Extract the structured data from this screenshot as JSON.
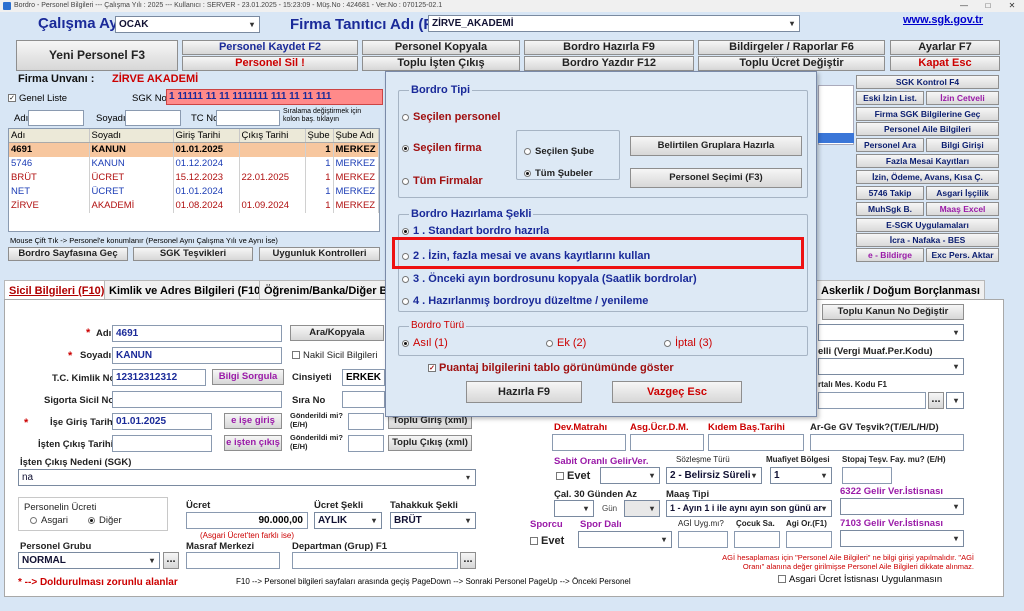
{
  "titlebar": {
    "text": "Bordro - Personel Bilgileri   ---  Çalışma Yılı : 2025   ---   Kullanıcı : SERVER - 23.01.2025 - 15:23:09 - Müş.No : 424681 - Ver.No : 070125-02.1"
  },
  "header": {
    "calisma_ayi_label": "Çalışma Ayı",
    "calisma_ayi_value": "OCAK",
    "firma_label": "Firma Tanıtıcı Adı (F8)",
    "firma_value": "ZİRVE_AKADEMİ",
    "sgk_link": "www.sgk.gov.tr"
  },
  "toolbar": {
    "yeni_personel": "Yeni Personel F3",
    "personel_kaydet": "Personel Kaydet F2",
    "personel_sil": "Personel Sil !",
    "personel_kopyala": "Personel Kopyala",
    "toplu_isten_cikis": "Toplu İşten Çıkış",
    "bordro_hazirla": "Bordro Hazırla F9",
    "bordro_yazdir": "Bordro Yazdır F12",
    "bildirgeler": "Bildirgeler / Raporlar F6",
    "toplu_ucret": "Toplu Ücret Değiştir",
    "ayarlar": "Ayarlar F7",
    "kapat": "Kapat Esc"
  },
  "left": {
    "firma_unvani_label": "Firma Unvanı :",
    "firma_unvani_value": "ZİRVE AKADEMİ",
    "genel_liste": "Genel Liste",
    "sgk_no_label": "SGK No",
    "sgk_no_value": "1 11111 11 11 1111111 111 11 11 111",
    "adi_label": "Adı",
    "soyadi_label": "Soyadı",
    "tc_no_label": "TC No",
    "siralama_note": "Sıralama değiştirmek için kolon baş. tıklayın",
    "mouse_note": "Mouse Çift Tık -> Personel'e konumlanır (Personel Aynı Çalışma Yılı ve Aynı İse)",
    "bordro_sayfasina": "Bordro Sayfasına Geç",
    "sgk_tesvikleri": "SGK Teşvikleri",
    "uygunluk": "Uygunluk Kontrolleri"
  },
  "grid": {
    "headers": [
      "Adı",
      "Soyadı",
      "Giriş Tarihi",
      "Çıkış Tarihi",
      "Şube",
      "Şube Adı"
    ],
    "rows": [
      [
        "4691",
        "KANUN",
        "01.01.2025",
        "",
        "1",
        "MERKEZ"
      ],
      [
        "5746",
        "KANUN",
        "01.12.2024",
        "",
        "1",
        "MERKEZ"
      ],
      [
        "BRÜT",
        "ÜCRET",
        "15.12.2023",
        "22.01.2025",
        "1",
        "MERKEZ"
      ],
      [
        "NET",
        "ÜCRET",
        "01.01.2024",
        "",
        "1",
        "MERKEZ"
      ],
      [
        "ZİRVE",
        "AKADEMİ",
        "01.08.2024",
        "01.09.2024",
        "1",
        "MERKEZ"
      ]
    ]
  },
  "right": {
    "sgk_kontrol": "SGK Kontrol F4",
    "eski_izin": "Eski İzin List.",
    "izin_cetveli": "İzin Cetveli",
    "firma_sgk": "Firma SGK Bilgilerine Geç",
    "personel_aile": "Personel Aile Bilgileri",
    "personel_ara": "Personel Ara",
    "bilgi_girisi": "Bilgi Girişi",
    "fazla_mesai": "Fazla Mesai Kayıtları",
    "izin_odeme": "İzin, Ödeme, Avans, Kısa Ç.",
    "takip_5746": "5746 Takip",
    "asgari_iscilik": "Asgari İşçilik",
    "muhsgk": "MuhSgk B.",
    "mas_excel": "Maaş Excel",
    "esgk": "E-SGK Uygulamaları",
    "icra": "İcra - Nafaka - BES",
    "ebildirge": "e - Bildirge",
    "exc_pers": "Exc Pers. Aktar"
  },
  "tabs": [
    "Sicil Bilgileri (F10)",
    "Kimlik ve Adres Bilgileri (F10)",
    "Öğrenim/Banka/Diğer Bil",
    "Askerlik / Doğum Borçlanması"
  ],
  "form": {
    "adi": "Adı",
    "adi_val": "4691",
    "ara_kopyala": "Ara/Kopyala",
    "soyadi": "Soyadı",
    "soyadi_val": "KANUN",
    "nakil": "Nakil Sicil Bilgileri",
    "tc": "T.C. Kimlik No",
    "tc_val": "12312312312",
    "bilgi_sorgula": "Bilgi Sorgula",
    "cinsiyet": "Cinsiyeti",
    "cinsiyet_val": "ERKEK",
    "sigorta": "Sigorta Sicil No",
    "sira_no": "Sıra No",
    "ise_giris": "İşe Giriş Tarihi",
    "ise_giris_val": "01.01.2025",
    "e_ise_giris": "e işe giriş",
    "gonderildi1": "Gönderildi mi? (E/H)",
    "isten_cikis": "İşten Çıkış Tarihi",
    "e_isten_cikis": "e işten çıkış",
    "gonderildi2": "Gönderildi mi? (E/H)",
    "isten_cikis_nedeni": "İşten Çıkış Nedeni (SGK)",
    "neden_val": "na",
    "personelin_ucreti": "Personelin Ücreti",
    "asgari": "Asgari",
    "diger": "Diğer",
    "ucret": "Ücret",
    "ucret_val": "90.000,00",
    "asgari_farkli": "(Asgari Ücret'ten farklı ise)",
    "ucret_sekli": "Ücret Şekli",
    "ucret_sekli_val": "AYLIK",
    "tahakkuk": "Tahakkuk Şekli",
    "tahakkuk_val": "BRÜT",
    "personel_grubu": "Personel Grubu",
    "personel_grubu_val": "NORMAL",
    "masraf": "Masraf Merkezi",
    "departman": "Departman (Grup) F1",
    "zorunlu": "--> Doldurulması zorunlu alanlar",
    "f10_note": "F10 --> Personel bilgileri sayfaları arasında geçiş  PageDown --> Sonraki Personel  PageUp --> Önceki Personel",
    "toplu_giris": "Toplu Giriş (xml)",
    "toplu_cikis": "Toplu Çıkış (xml)"
  },
  "rform": {
    "toplu_kanun": "Toplu Kanun No Değiştir",
    "vergi_muaf": "elli (Vergi Muaf.Per.Kodu)",
    "mes_kodu": "rtalı Mes. Kodu F1",
    "dev_matrahi": "Dev.Matrahı",
    "asg_ucr": "Asg.Ücr.D.M.",
    "kidem": "Kıdem Baş.Tarihi",
    "arge": "Ar-Ge GV Teşvik?(T/E/L/H/D)",
    "sabit_oranli": "Sabit Oranlı GelirVer.",
    "sozlesme": "Sözleşme Türü",
    "muafiyet": "Muafiyet Bölgesi",
    "stopaj": "Stopaj Teşv. Fay. mu? (E/H)",
    "evet": "Evet",
    "sozlesme_val": "2 - Belirsiz Süreli",
    "muaf_val": "1",
    "cal30": "Çal. 30 Günden Az",
    "maas_tipi": "Maaş Tipi",
    "gelir6322": "6322 Gelir Ver.İstisnası",
    "gun": "Gün",
    "maas_val": "1 - Ayın 1 i ile aynı ayın son günü ar",
    "sporcu": "Sporcu",
    "spor_dali": "Spor Dalı",
    "agi_uyg": "AGİ Uyg.mı?",
    "cocuk": "Çocuk Sa.",
    "agi_oran": "Agi Or.(F1)",
    "gelir7103": "7103 Gelir Ver.İstisnası",
    "evet2": "Evet",
    "agi_note": "AGİ hesaplaması için \"Personel Aile Bilgileri\" ne bilgi girişi yapılmalıdır. \"AGİ Oranı\" alanına değer girilmişse Personel Aile Bilgileri dikkate alınmaz.",
    "asgari_istisna": "Asgari Ücret İstisnası Uygulanmasın"
  },
  "dialog": {
    "bordro_tipi": "Bordro Tipi",
    "secilen_personel": "Seçilen personel",
    "secilen_firma": "Seçilen firma",
    "tum_firmalar": "Tüm Firmalar",
    "secilen_sube": "Seçilen Şube",
    "tum_subeler": "Tüm Şubeler",
    "belirtilen": "Belirtilen Gruplara Hazırla",
    "personel_secimi": "Personel Seçimi (F3)",
    "hazirlama_sekli": "Bordro Hazırlama Şekli",
    "opt1": "1 . Standart bordro hazırla",
    "opt2": "2 . İzin, fazla mesai ve avans kayıtlarını kullan",
    "opt3": "3 . Önceki ayın bordrosunu kopyala (Saatlik bordrolar)",
    "opt4": "4 . Hazırlanmış bordroyu düzeltme / yenileme",
    "bordro_turu": "Bordro Türü",
    "asil": "Asıl (1)",
    "ek": "Ek (2)",
    "iptal": "İptal (3)",
    "puantaj": "Puantaj bilgilerini tablo görünümünde göster",
    "hazirla": "Hazırla F9",
    "vazgec": "Vazgeç Esc"
  }
}
